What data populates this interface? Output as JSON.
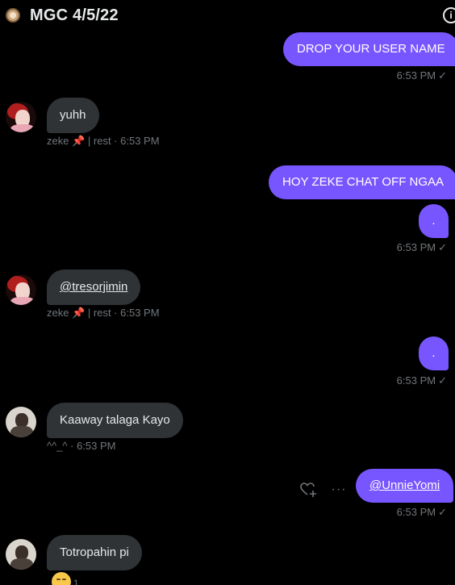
{
  "header": {
    "title": "MGC 4/5/22",
    "info_icon": "i"
  },
  "messages": [
    {
      "text": "DROP YOUR USER NAME",
      "meta": "6:53 PM"
    },
    {
      "text": "yuhh",
      "sender": "zeke",
      "sender_suffix": "| rest · 6:53 PM"
    },
    {
      "text": "HOY ZEKE CHAT OFF NGAA"
    },
    {
      "text": ".",
      "meta": "6:53 PM"
    },
    {
      "text": "@tresorjimin",
      "sender": "zeke",
      "sender_suffix": "| rest · 6:53 PM"
    },
    {
      "text": ".",
      "meta": "6:53 PM"
    },
    {
      "text": "Kaaway talaga Kayo",
      "meta": "^^_^ · 6:53 PM"
    },
    {
      "text": "@UnnieYomi",
      "meta": "6:53 PM"
    },
    {
      "text": "Totropahin pi",
      "reaction_count": "1"
    }
  ],
  "icons": {
    "pin": "📌",
    "check": "✓",
    "more": "···",
    "heart_add": "heart-plus-icon"
  },
  "colors": {
    "outgoing": "#7856ff",
    "incoming": "#2f3336",
    "meta": "#71767b"
  }
}
